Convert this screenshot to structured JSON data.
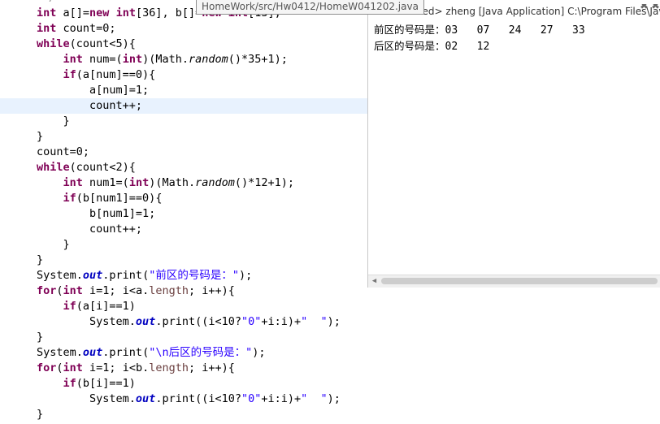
{
  "tooltip": {
    "path": "HomeWork/src/Hw0412/HomeW041202.java"
  },
  "editor": {
    "top_fragment": "/",
    "lines": [
      [
        {
          "t": "int",
          "c": "kw"
        },
        {
          "t": " a[]="
        },
        {
          "t": "new",
          "c": "kw"
        },
        {
          "t": " "
        },
        {
          "t": "int",
          "c": "kw"
        },
        {
          "t": "[36], b[]="
        },
        {
          "t": "new",
          "c": "kw"
        },
        {
          "t": " "
        },
        {
          "t": "int",
          "c": "kw"
        },
        {
          "t": "[13];"
        }
      ],
      [
        {
          "t": "int",
          "c": "kw"
        },
        {
          "t": " count=0;"
        }
      ],
      [
        {
          "t": "while",
          "c": "kw"
        },
        {
          "t": "(count<5){"
        }
      ],
      [
        {
          "t": "    "
        },
        {
          "t": "int",
          "c": "kw"
        },
        {
          "t": " num=("
        },
        {
          "t": "int",
          "c": "kw"
        },
        {
          "t": ")(Math."
        },
        {
          "t": "random",
          "c": "mth"
        },
        {
          "t": "()*35+1);"
        }
      ],
      [
        {
          "t": "    "
        },
        {
          "t": "if",
          "c": "kw"
        },
        {
          "t": "(a[num]==0){"
        }
      ],
      [
        {
          "t": "        a[num]=1;"
        }
      ],
      [
        {
          "t": "        count++;"
        }
      ],
      [
        {
          "t": "    }"
        }
      ],
      [
        {
          "t": "}"
        }
      ],
      [
        {
          "t": "count=0;"
        }
      ],
      [
        {
          "t": "while",
          "c": "kw"
        },
        {
          "t": "(count<2){"
        }
      ],
      [
        {
          "t": "    "
        },
        {
          "t": "int",
          "c": "kw"
        },
        {
          "t": " num1=("
        },
        {
          "t": "int",
          "c": "kw"
        },
        {
          "t": ")(Math."
        },
        {
          "t": "random",
          "c": "mth"
        },
        {
          "t": "()*12+1);"
        }
      ],
      [
        {
          "t": "    "
        },
        {
          "t": "if",
          "c": "kw"
        },
        {
          "t": "(b[num1]==0){"
        }
      ],
      [
        {
          "t": "        b[num1]=1;"
        }
      ],
      [
        {
          "t": "        count++;"
        }
      ],
      [
        {
          "t": "    }"
        }
      ],
      [
        {
          "t": "}"
        }
      ],
      [
        {
          "t": "System."
        },
        {
          "t": "out",
          "c": "fld"
        },
        {
          "t": ".print("
        },
        {
          "t": "\"前区的号码是：\"",
          "c": "str"
        },
        {
          "t": ");"
        }
      ],
      [
        {
          "t": "for",
          "c": "kw"
        },
        {
          "t": "("
        },
        {
          "t": "int",
          "c": "kw"
        },
        {
          "t": " i=1; i<a."
        },
        {
          "t": "length",
          "c": "var"
        },
        {
          "t": "; i++){"
        }
      ],
      [
        {
          "t": "    "
        },
        {
          "t": "if",
          "c": "kw"
        },
        {
          "t": "(a[i]==1)"
        }
      ],
      [
        {
          "t": "        System."
        },
        {
          "t": "out",
          "c": "fld"
        },
        {
          "t": ".print((i<10?"
        },
        {
          "t": "\"0\"",
          "c": "str"
        },
        {
          "t": "+i:i)+"
        },
        {
          "t": "\"  \"",
          "c": "str"
        },
        {
          "t": ");"
        }
      ],
      [
        {
          "t": "}"
        }
      ],
      [
        {
          "t": "System."
        },
        {
          "t": "out",
          "c": "fld"
        },
        {
          "t": ".print("
        },
        {
          "t": "\"\\n后区的号码是：\"",
          "c": "str"
        },
        {
          "t": ");"
        }
      ],
      [
        {
          "t": "for",
          "c": "kw"
        },
        {
          "t": "("
        },
        {
          "t": "int",
          "c": "kw"
        },
        {
          "t": " i=1; i<b."
        },
        {
          "t": "length",
          "c": "var"
        },
        {
          "t": "; i++){"
        }
      ],
      [
        {
          "t": "    "
        },
        {
          "t": "if",
          "c": "kw"
        },
        {
          "t": "(b[i]==1)"
        }
      ],
      [
        {
          "t": "        System."
        },
        {
          "t": "out",
          "c": "fld"
        },
        {
          "t": ".print((i<10?"
        },
        {
          "t": "\"0\"",
          "c": "str"
        },
        {
          "t": "+i:i)+"
        },
        {
          "t": "\"  \"",
          "c": "str"
        },
        {
          "t": ");"
        }
      ],
      [
        {
          "t": "}"
        }
      ]
    ],
    "current_line": 6
  },
  "console": {
    "title": "<terminated> zheng [Java Application] C:\\Program Files\\Java",
    "front_label": "前区的号码是：",
    "front_numbers": "03   07   24   27   33",
    "back_label": "后区的号码是：",
    "back_numbers": "02   12"
  }
}
